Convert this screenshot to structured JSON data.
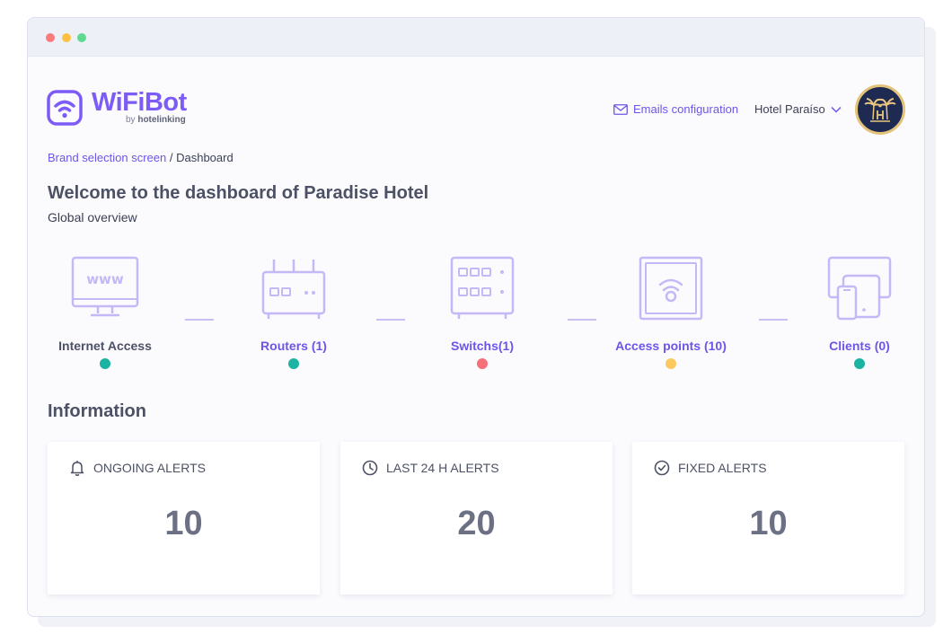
{
  "brand": {
    "name": "WiFiBot",
    "by_prefix": "by",
    "by_company": "hotelinking",
    "accent": "#7c5cf5"
  },
  "header": {
    "email_link_label": "Emails configuration",
    "hotel_selector_value": "Hotel Paraíso",
    "avatar_icon": "palm-trees-logo"
  },
  "breadcrumb": {
    "parent": "Brand selection screen",
    "separator": " / ",
    "current": "Dashboard"
  },
  "page": {
    "title": "Welcome to the dashboard of Paradise Hotel",
    "subtitle": "Global overview"
  },
  "network": {
    "nodes": [
      {
        "label": "Internet Access",
        "icon": "www-monitor-icon",
        "status_color": "#1db3a2",
        "link": false
      },
      {
        "label": "Routers (1)",
        "icon": "router-icon",
        "status_color": "#1db3a2",
        "link": true
      },
      {
        "label": "Switchs(1)",
        "icon": "switch-icon",
        "status_color": "#f6707a",
        "link": true
      },
      {
        "label": "Access points (10)",
        "icon": "access-point-icon",
        "status_color": "#fcc85f",
        "link": true
      },
      {
        "label": "Clients (0)",
        "icon": "devices-icon",
        "status_color": "#1db3a2",
        "link": true
      }
    ]
  },
  "information": {
    "title": "Information",
    "cards": [
      {
        "label": "ONGOING ALERTS",
        "value": "10",
        "icon": "bell-icon"
      },
      {
        "label": "LAST 24 H ALERTS",
        "value": "20",
        "icon": "clock-icon"
      },
      {
        "label": "FIXED ALERTS",
        "value": "10",
        "icon": "check-circle-icon"
      }
    ]
  }
}
